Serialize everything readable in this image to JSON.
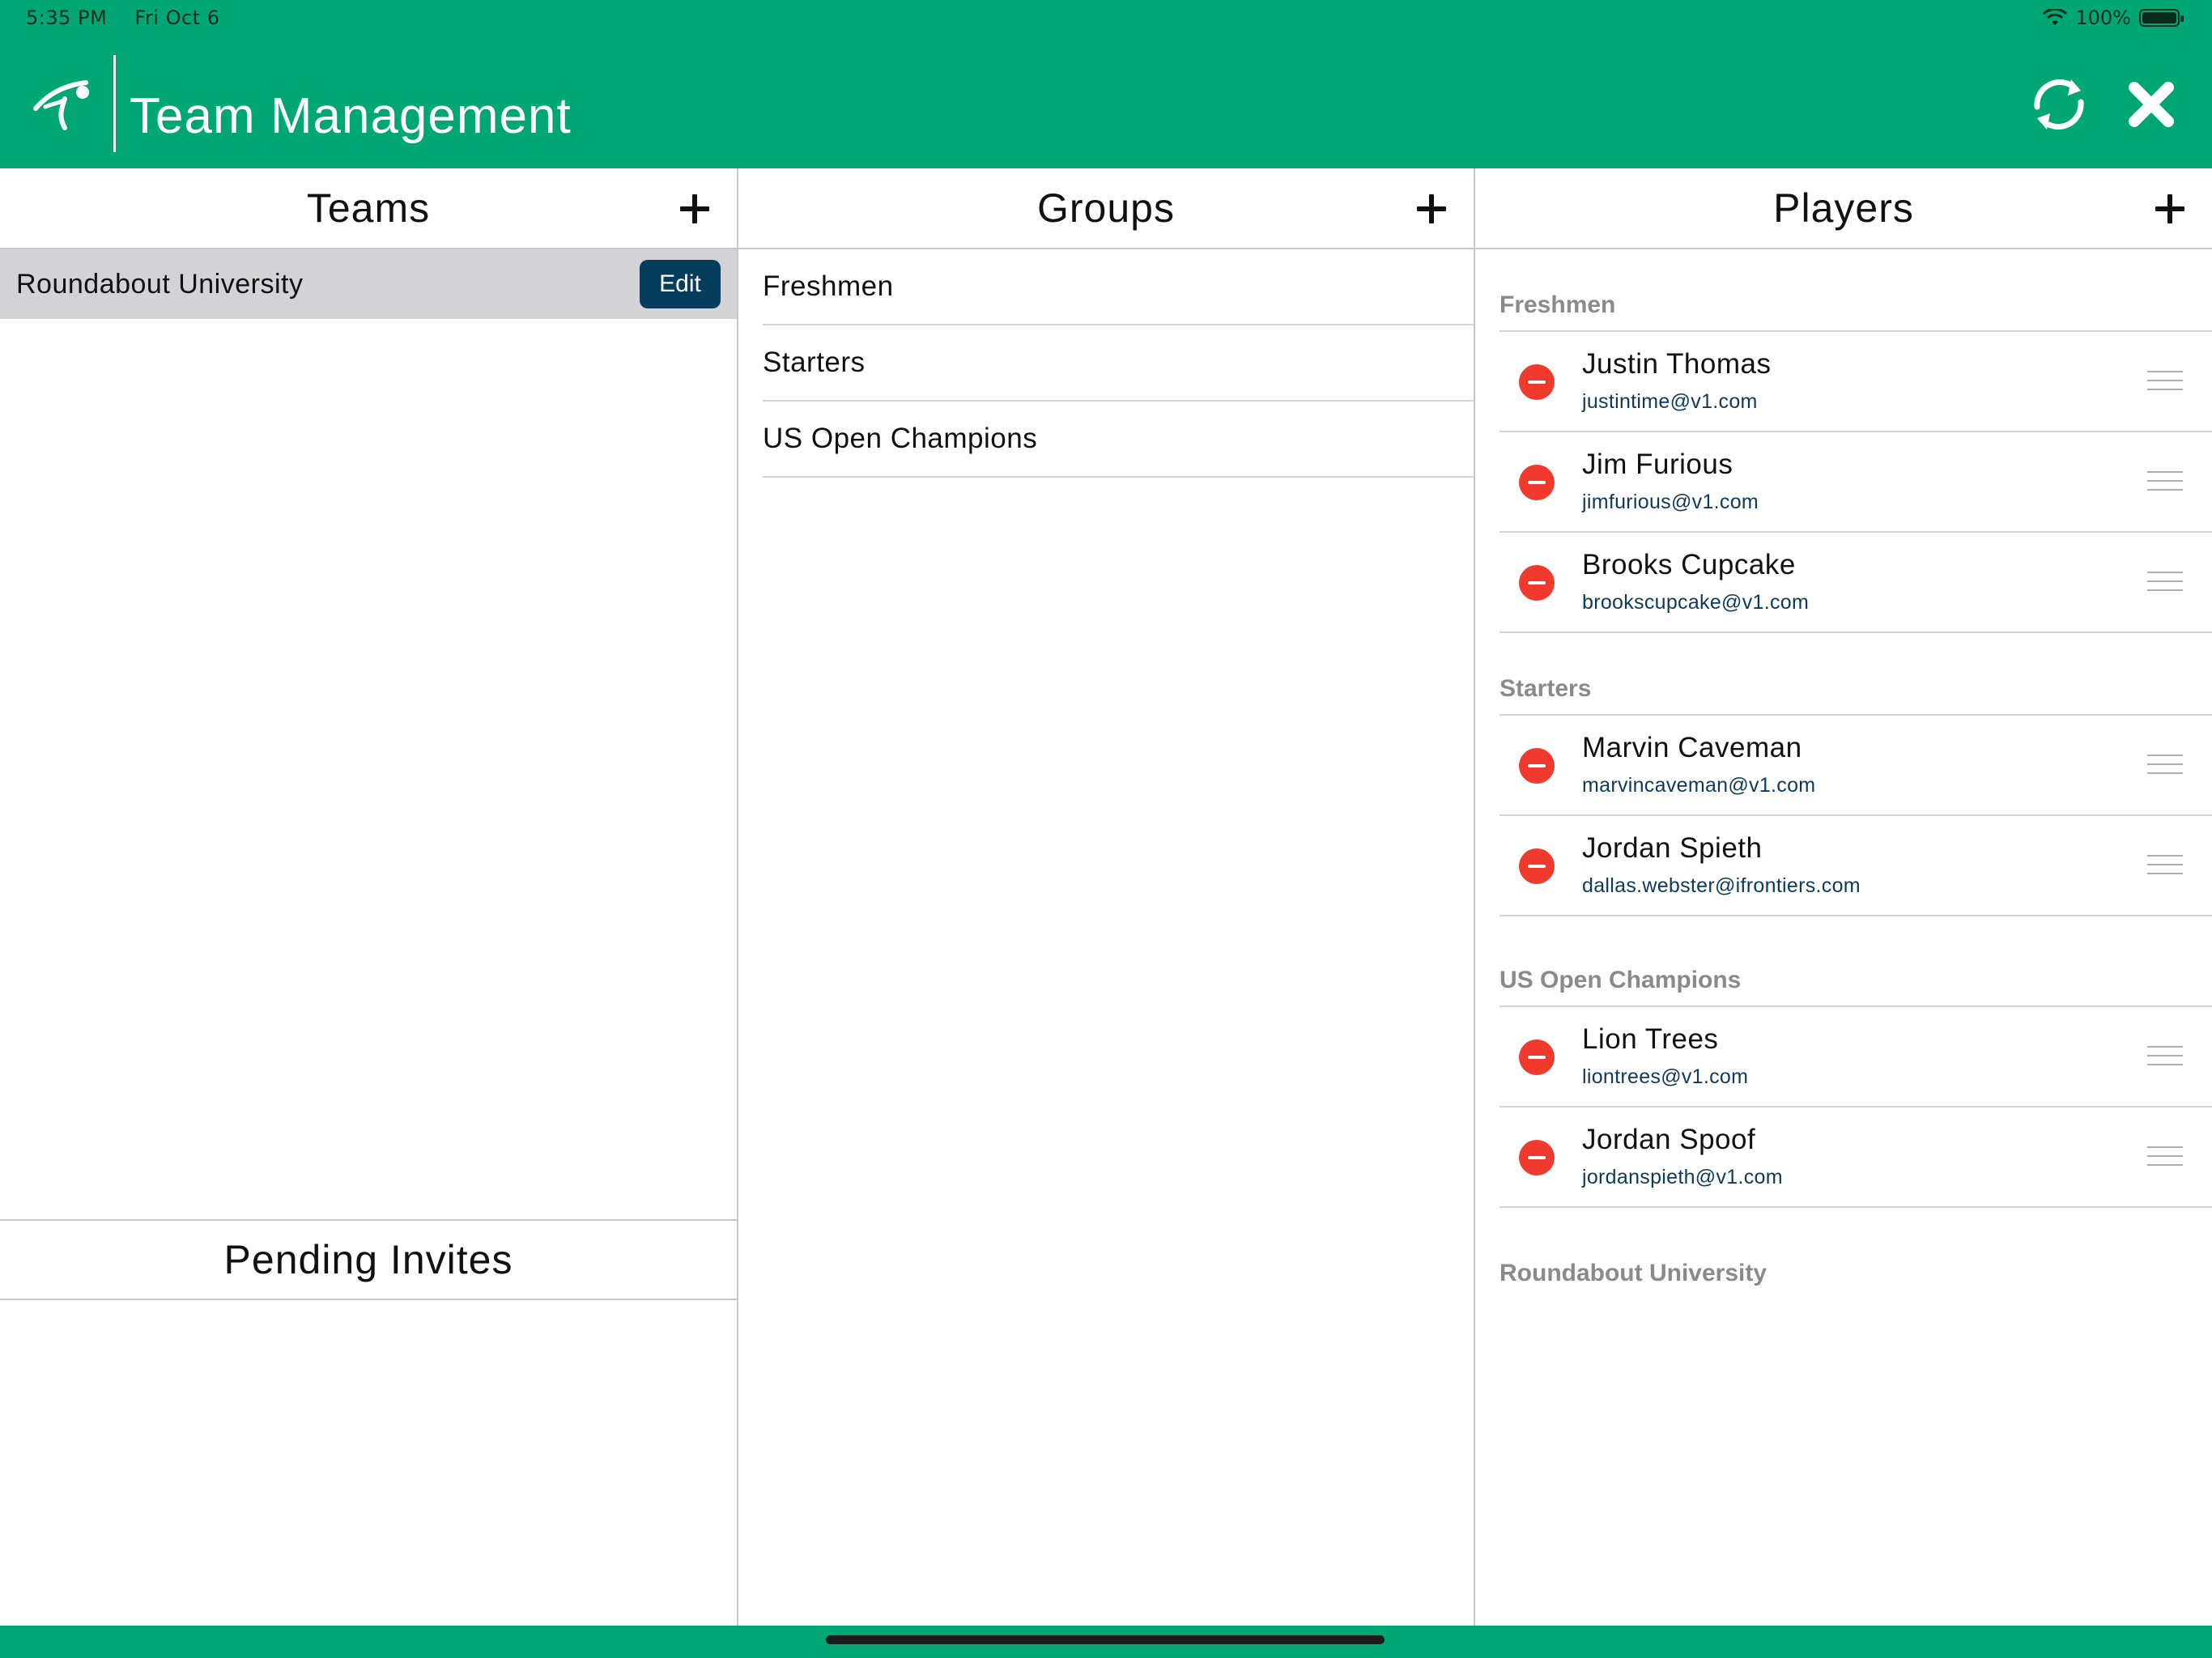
{
  "status_bar": {
    "time": "5:35 PM",
    "date": "Fri Oct 6",
    "battery": "100%"
  },
  "header": {
    "title": "Team Management",
    "icons": [
      "logo-icon",
      "refresh-icon",
      "close-icon"
    ]
  },
  "teams": {
    "title": "Teams",
    "items": [
      {
        "name": "Roundabout University",
        "edit_label": "Edit"
      }
    ]
  },
  "pending_invites": {
    "title": "Pending Invites"
  },
  "groups": {
    "title": "Groups",
    "items": [
      "Freshmen",
      "Starters",
      "US Open Champions"
    ]
  },
  "players": {
    "title": "Players",
    "sections": [
      {
        "name": "Freshmen",
        "players": [
          {
            "name": "Justin Thomas",
            "email": "justintime@v1.com"
          },
          {
            "name": "Jim Furious",
            "email": "jimfurious@v1.com"
          },
          {
            "name": "Brooks Cupcake",
            "email": "brookscupcake@v1.com"
          }
        ]
      },
      {
        "name": "Starters",
        "players": [
          {
            "name": "Marvin Caveman",
            "email": "marvincaveman@v1.com"
          },
          {
            "name": "Jordan Spieth",
            "email": "dallas.webster@ifrontiers.com"
          }
        ]
      },
      {
        "name": "US Open Champions",
        "players": [
          {
            "name": "Lion Trees",
            "email": "liontrees@v1.com"
          },
          {
            "name": "Jordan Spoof",
            "email": "jordanspieth@v1.com"
          }
        ]
      },
      {
        "name": "Roundabout University",
        "players": []
      }
    ]
  },
  "colors": {
    "brand_green": "#00a673",
    "edit_button": "#063d5d",
    "remove_red": "#f03a2e",
    "selected_row": "#d2d2d7",
    "email_text": "#0d3a5a"
  }
}
